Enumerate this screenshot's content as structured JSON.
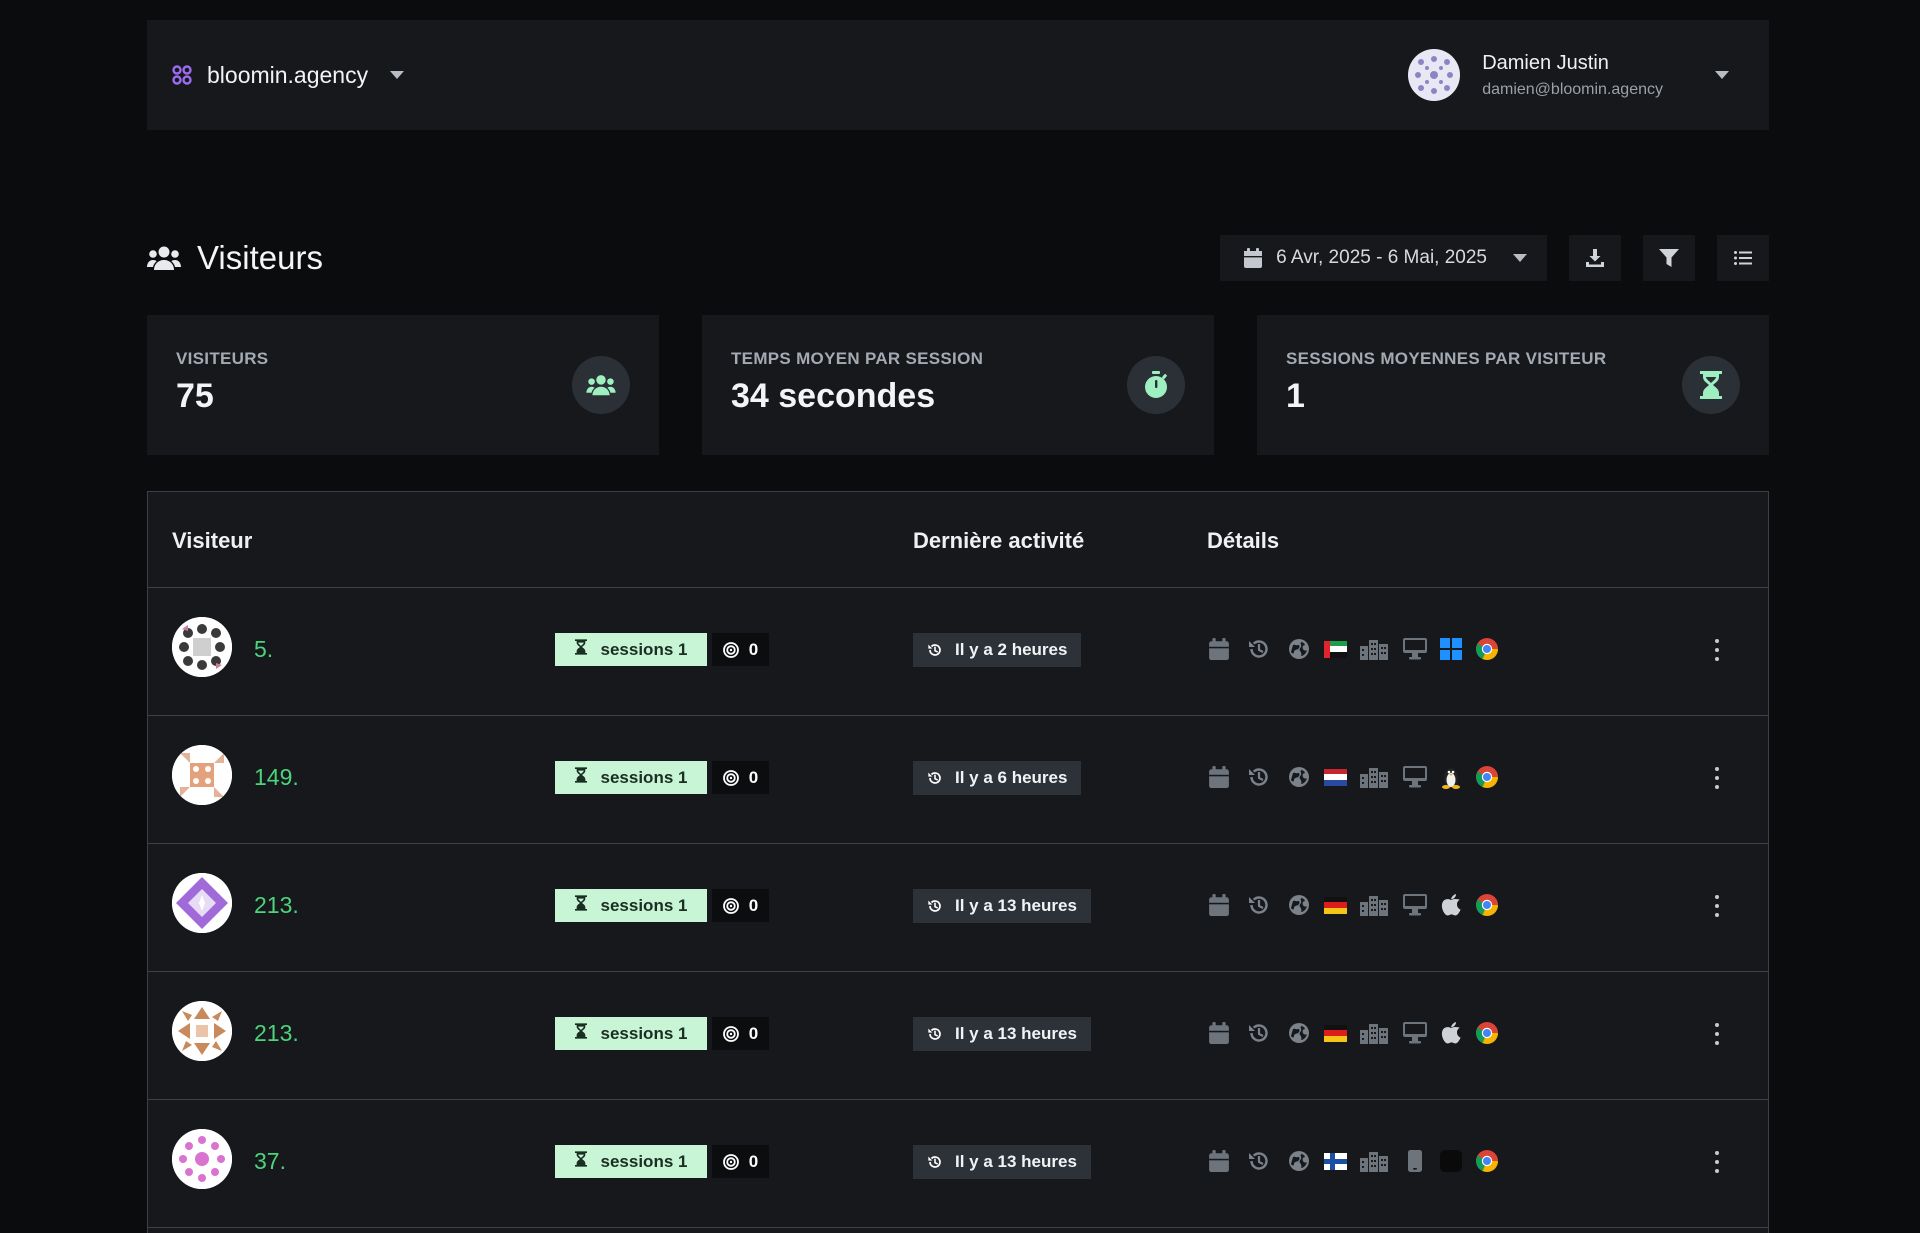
{
  "org": {
    "name": "bloomin.agency"
  },
  "user": {
    "name": "Damien Justin",
    "email": "damien@bloomin.agency"
  },
  "page": {
    "title": "Visiteurs",
    "date_range": "6 Avr, 2025 - 6 Mai, 2025"
  },
  "stats": [
    {
      "label": "VISITEURS",
      "value": "75",
      "icon": "users-icon"
    },
    {
      "label": "TEMPS MOYEN PAR SESSION",
      "value": "34 secondes",
      "icon": "stopwatch-icon"
    },
    {
      "label": "SESSIONS MOYENNES PAR VISITEUR",
      "value": "1",
      "icon": "hourglass-icon"
    }
  ],
  "table": {
    "headers": {
      "visitor": "Visiteur",
      "activity": "Dernière activité",
      "details": "Détails"
    },
    "rows": [
      {
        "id": "5.",
        "sessions": "sessions 1",
        "goals": "0",
        "activity": "Il y a 2 heures",
        "country": "ae",
        "os": "windows",
        "device": "desktop"
      },
      {
        "id": "149.",
        "sessions": "sessions 1",
        "goals": "0",
        "activity": "Il y a 6 heures",
        "country": "nl",
        "os": "linux",
        "device": "desktop"
      },
      {
        "id": "213.",
        "sessions": "sessions 1",
        "goals": "0",
        "activity": "Il y a 13 heures",
        "country": "de",
        "os": "apple",
        "device": "desktop"
      },
      {
        "id": "213.",
        "sessions": "sessions 1",
        "goals": "0",
        "activity": "Il y a 13 heures",
        "country": "de",
        "os": "apple",
        "device": "desktop"
      },
      {
        "id": "37.",
        "sessions": "sessions 1",
        "goals": "0",
        "activity": "Il y a 13 heures",
        "country": "fi",
        "os": "unknown",
        "device": "mobile"
      }
    ]
  },
  "colors": {
    "accent_green": "#4cd47c",
    "session_badge": "#c9f5d7",
    "brand_purple": "#8b5cf6"
  }
}
